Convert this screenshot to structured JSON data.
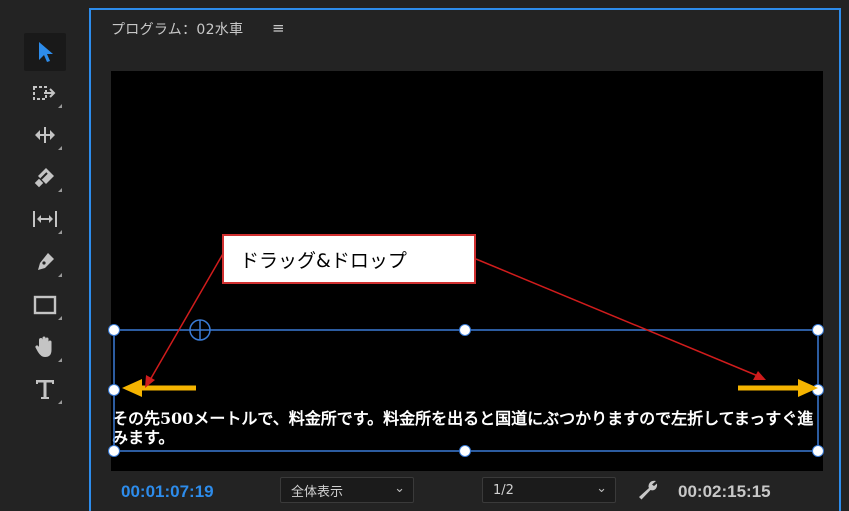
{
  "panel": {
    "title": "プログラム：02水車",
    "menu_icon": "hamburger-menu-icon"
  },
  "toolbar": {
    "tools": [
      {
        "name": "selection-tool",
        "icon": "arrow-pointer-icon",
        "active": true
      },
      {
        "name": "track-select-tool",
        "icon": "track-select-icon"
      },
      {
        "name": "ripple-edit-tool",
        "icon": "ripple-edit-icon"
      },
      {
        "name": "razor-tool",
        "icon": "razor-icon"
      },
      {
        "name": "slip-tool",
        "icon": "slip-icon"
      },
      {
        "name": "pen-tool",
        "icon": "pen-icon"
      },
      {
        "name": "rectangle-tool",
        "icon": "rectangle-icon"
      },
      {
        "name": "hand-tool",
        "icon": "hand-icon"
      },
      {
        "name": "type-tool",
        "icon": "type-icon"
      }
    ]
  },
  "monitor": {
    "caption_text": "その先500メートルで、料金所です。料金所を出ると国道にぶつかりますので左折してまっすぐ進みます。"
  },
  "annotation": {
    "callout_text": "ドラッグ&ドロップ",
    "callout_border_color": "#d03030",
    "arrow_color": "#f5b400"
  },
  "footer": {
    "current_timecode": "00:01:07:19",
    "zoom_select": "全体表示",
    "resolution_select": "1/2",
    "settings_icon": "wrench-icon",
    "duration_timecode": "00:02:15:15"
  },
  "colors": {
    "accent": "#2d8ceb",
    "background": "#232323"
  }
}
